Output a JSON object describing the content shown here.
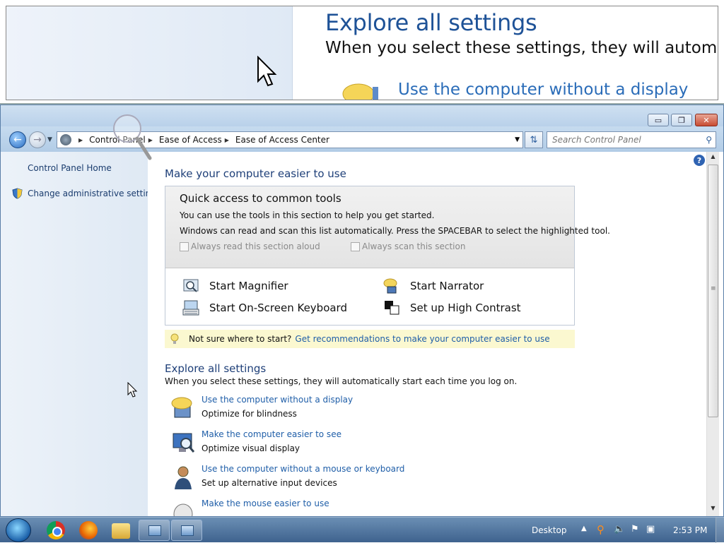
{
  "magnifier": {
    "title": "Explore all settings",
    "description": "When you select these settings, they will automaticall",
    "link": "Use the computer without a display"
  },
  "window": {
    "controls": {
      "minimize": "▭",
      "restore": "❐",
      "close": "✕"
    }
  },
  "navbar": {
    "breadcrumbs": [
      "Control Panel",
      "Ease of Access",
      "Ease of Access Center"
    ],
    "search_placeholder": "Search Control Panel"
  },
  "sidebar": {
    "items": [
      {
        "label": "Control Panel Home"
      },
      {
        "label": "Change administrative settings",
        "icon": "shield-icon"
      }
    ]
  },
  "main": {
    "page_title": "Make your computer easier to use",
    "quick_access": {
      "title": "Quick access to common tools",
      "line1": "You can use the tools in this section to help you get started.",
      "line2": "Windows can read and scan this list automatically.  Press the SPACEBAR to select the highlighted tool.",
      "checkboxes": [
        {
          "label": "Always read this section aloud",
          "checked": false
        },
        {
          "label": "Always scan this section",
          "checked": false
        }
      ],
      "tools": [
        {
          "label": "Start Magnifier",
          "icon": "magnifier-icon"
        },
        {
          "label": "Start Narrator",
          "icon": "narrator-icon"
        },
        {
          "label": "Start On-Screen Keyboard",
          "icon": "keyboard-icon"
        },
        {
          "label": "Set up High Contrast",
          "icon": "contrast-icon"
        }
      ]
    },
    "tip": {
      "text": "Not sure where to start?",
      "link": "Get recommendations to make your computer easier to use"
    },
    "explore": {
      "title": "Explore all settings",
      "description": "When you select these settings, they will automatically start each time you log on.",
      "settings": [
        {
          "link": "Use the computer without a display",
          "subtitle": "Optimize for blindness"
        },
        {
          "link": "Make the computer easier to see",
          "subtitle": "Optimize visual display"
        },
        {
          "link": "Use the computer without a mouse or keyboard",
          "subtitle": "Set up alternative input devices"
        },
        {
          "link": "Make the mouse easier to use",
          "subtitle": ""
        }
      ]
    }
  },
  "taskbar": {
    "desktop_label": "Desktop",
    "clock": "2:53 PM"
  },
  "colors": {
    "link": "#1f5ea8",
    "heading": "#1e3f78",
    "tip_bg": "#fbf8d0",
    "sidebar_bg": "#e6eef7"
  }
}
